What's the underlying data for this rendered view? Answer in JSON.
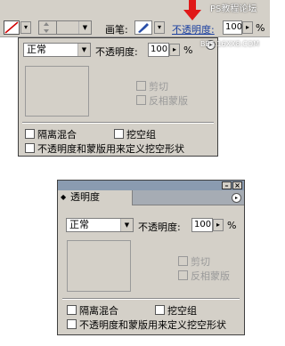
{
  "options_bar": {
    "brush_label": "画笔:",
    "opacity_label": "不透明度:",
    "opacity_value": "100",
    "percent": "%",
    "arrow_color": "#e01818"
  },
  "watermark": {
    "line1": "PS教程论坛",
    "line2": "BBS.16XX8.COM"
  },
  "dropdown_panel": {
    "blend_mode": "正常",
    "opacity_label": "不透明度:",
    "opacity_value": "100",
    "percent": "%",
    "clip_label": "剪切",
    "invert_label": "反相蒙版",
    "isolate_label": "隔离混合",
    "knockout_label": "挖空组",
    "define_knockout_label": "不透明度和蒙版用来定义挖空形状"
  },
  "palette": {
    "tab_label": "透明度",
    "blend_mode": "正常",
    "opacity_label": "不透明度:",
    "opacity_value": "100",
    "percent": "%",
    "clip_label": "剪切",
    "invert_label": "反相蒙版",
    "isolate_label": "隔离混合",
    "knockout_label": "挖空组",
    "define_knockout_label": "不透明度和蒙版用来定义挖空形状"
  }
}
